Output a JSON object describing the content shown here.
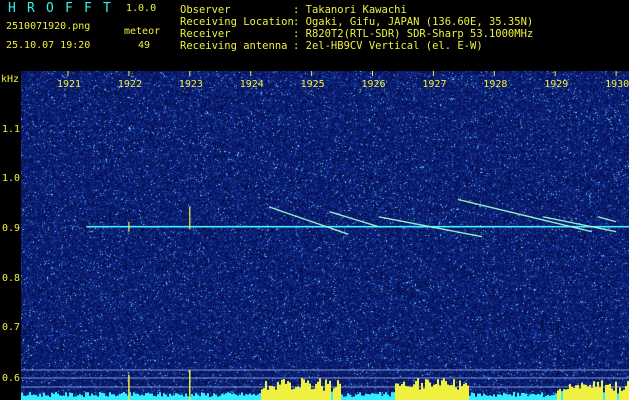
{
  "app": {
    "logo_letters": [
      "H",
      "R",
      "O",
      "F",
      "F",
      "T"
    ],
    "version": "1.0.0"
  },
  "file": {
    "name": "2510071920.png",
    "datetime": "25.10.07 19:20"
  },
  "counter": {
    "label": "meteor",
    "value": "49"
  },
  "info": {
    "rows": [
      {
        "key": "Observer",
        "value": ": Takanori Kawachi"
      },
      {
        "key": "Receiving Location",
        "value": ": Ogaki, Gifu, JAPAN (136.60E, 35.35N)"
      },
      {
        "key": "Receiver",
        "value": ": R820T2(RTL-SDR) SDR-Sharp 53.1000MHz"
      },
      {
        "key": "Receiving antenna",
        "value": ": 2el-HB9CV Vertical (el. E-W)"
      }
    ]
  },
  "chart_data": {
    "type": "heatmap",
    "ylabel": "kHz",
    "x_ticks": [
      "1921",
      "1922",
      "1923",
      "1924",
      "1925",
      "1926",
      "1927",
      "1928",
      "1929",
      "1930"
    ],
    "y_ticks": [
      "1.1",
      "1.0",
      "0.9",
      "0.8",
      "0.7",
      "0.6"
    ],
    "ylim": [
      0.58,
      1.19
    ],
    "carrier_khz": 0.905,
    "meteor_echoes": [
      {
        "t_start": 1924.3,
        "t_end": 1925.6,
        "f_start": 0.945,
        "f_end": 0.89
      },
      {
        "t_start": 1925.3,
        "t_end": 1926.1,
        "f_start": 0.935,
        "f_end": 0.905
      },
      {
        "t_start": 1926.1,
        "t_end": 1927.8,
        "f_start": 0.925,
        "f_end": 0.885
      },
      {
        "t_start": 1927.4,
        "t_end": 1929.6,
        "f_start": 0.96,
        "f_end": 0.895
      },
      {
        "t_start": 1928.8,
        "t_end": 1930.0,
        "f_start": 0.925,
        "f_end": 0.895
      },
      {
        "t_start": 1929.7,
        "t_end": 1930.0,
        "f_start": 0.925,
        "f_end": 0.915
      }
    ],
    "colors": {
      "background": "#0a1a6e",
      "carrier": "#40f0ff",
      "echo": "#a0ffd0",
      "grid": "#f0f040",
      "histogram": "#30f0ff",
      "spikes": "#f0f040"
    }
  }
}
